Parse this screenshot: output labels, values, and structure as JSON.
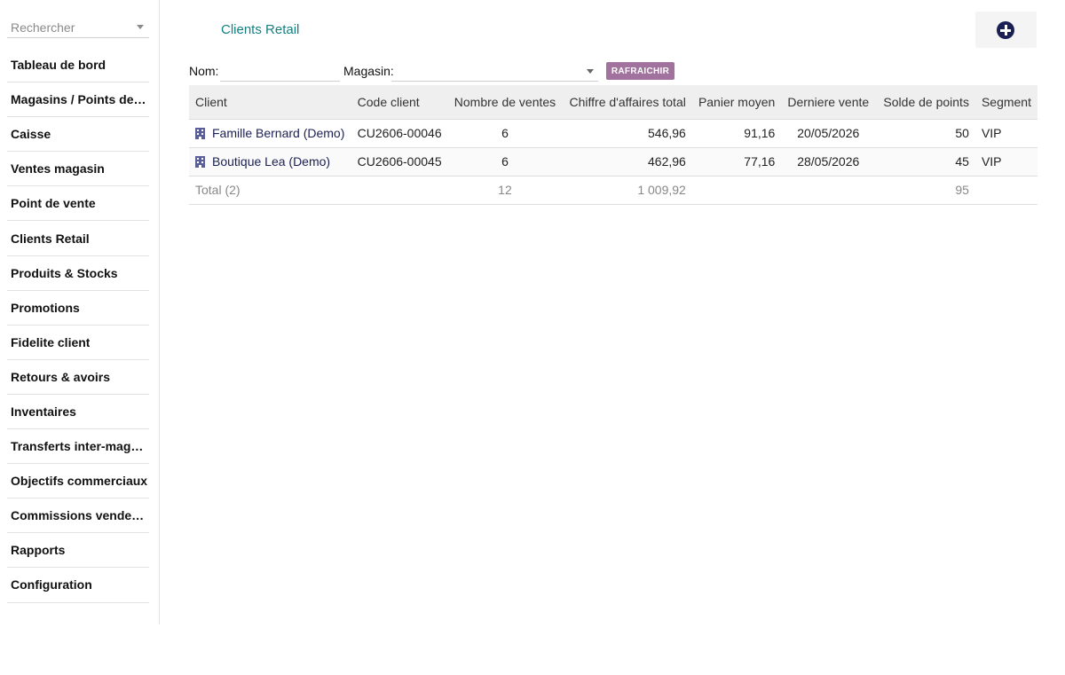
{
  "sidebar": {
    "search_placeholder": "Rechercher",
    "items": [
      {
        "label": "Tableau de bord"
      },
      {
        "label": "Magasins / Points de vente"
      },
      {
        "label": "Caisse"
      },
      {
        "label": "Ventes magasin"
      },
      {
        "label": "Point de vente"
      },
      {
        "label": "Clients Retail"
      },
      {
        "label": "Produits & Stocks"
      },
      {
        "label": "Promotions"
      },
      {
        "label": "Fidelite client"
      },
      {
        "label": "Retours & avoirs"
      },
      {
        "label": "Inventaires"
      },
      {
        "label": "Transferts inter-magasins"
      },
      {
        "label": "Objectifs commerciaux"
      },
      {
        "label": "Commissions vendeurs"
      },
      {
        "label": "Rapports"
      },
      {
        "label": "Configuration"
      }
    ]
  },
  "header": {
    "title": "Clients Retail",
    "add_icon": "plus-circle-icon"
  },
  "filters": {
    "name_label": "Nom:",
    "name_value": "",
    "store_label": "Magasin:",
    "store_value": "",
    "refresh_label": "RAFRAICHIR"
  },
  "table": {
    "columns": {
      "client": "Client",
      "code": "Code client",
      "sales": "Nombre de ventes",
      "revenue": "Chiffre d'affaires total",
      "basket": "Panier moyen",
      "last_sale": "Derniere vente",
      "points": "Solde de points",
      "segment": "Segment"
    },
    "rows": [
      {
        "client": "Famille Bernard (Demo)",
        "code": "CU2606-00046",
        "sales": "6",
        "revenue": "546,96",
        "basket": "91,16",
        "last_sale": "20/05/2026",
        "points": "50",
        "segment": "VIP"
      },
      {
        "client": "Boutique Lea (Demo)",
        "code": "CU2606-00045",
        "sales": "6",
        "revenue": "462,96",
        "basket": "77,16",
        "last_sale": "28/05/2026",
        "points": "45",
        "segment": "VIP"
      }
    ],
    "total": {
      "label": "Total (2)",
      "sales": "12",
      "revenue": "1 009,92",
      "points": "95"
    }
  },
  "colors": {
    "title": "#127f82",
    "link": "#1b2054",
    "button": "#a0729d",
    "header_bg": "#efefef"
  }
}
